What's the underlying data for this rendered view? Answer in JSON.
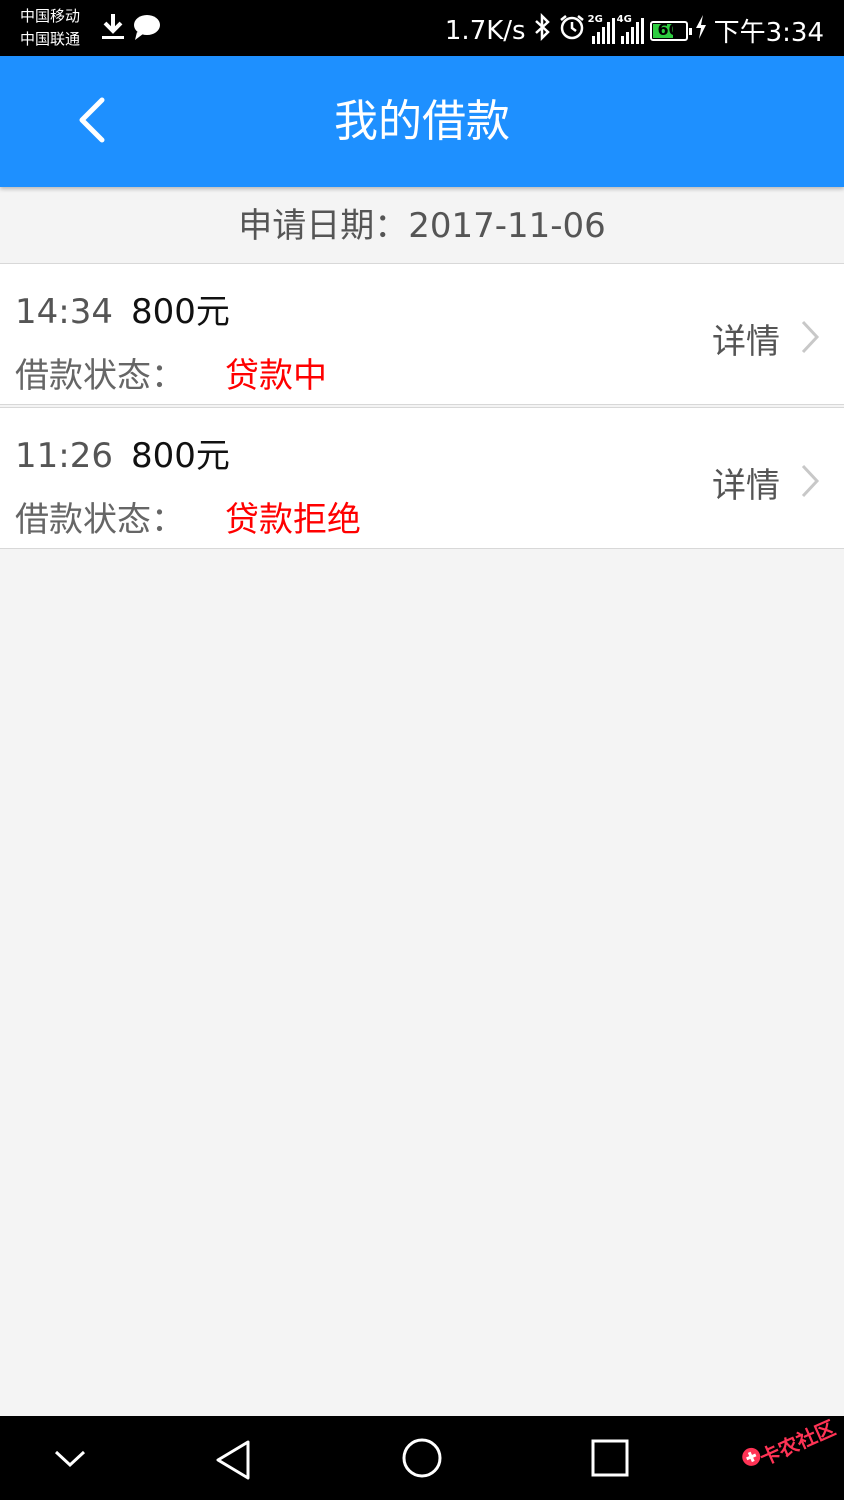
{
  "status_bar": {
    "carrier1": "中国移动",
    "carrier2": "中国联通",
    "net_speed": "1.7K/s",
    "signal1_label": "2G",
    "signal2_label": "4G",
    "battery": "60",
    "time": "下午3:34"
  },
  "header": {
    "title": "我的借款"
  },
  "date_bar": {
    "label": "申请日期：",
    "value": "2017-11-06"
  },
  "loans": [
    {
      "time": "14:34",
      "amount": "800元",
      "status_label": "借款状态：",
      "status": "贷款中",
      "detail_label": "详情"
    },
    {
      "time": "11:26",
      "amount": "800元",
      "status_label": "借款状态：",
      "status": "贷款拒绝",
      "detail_label": "详情"
    }
  ],
  "watermark": {
    "text": "卡农社区"
  },
  "colors": {
    "header": "#1e90ff",
    "status_red": "#ff0000",
    "background": "#f4f4f4"
  }
}
